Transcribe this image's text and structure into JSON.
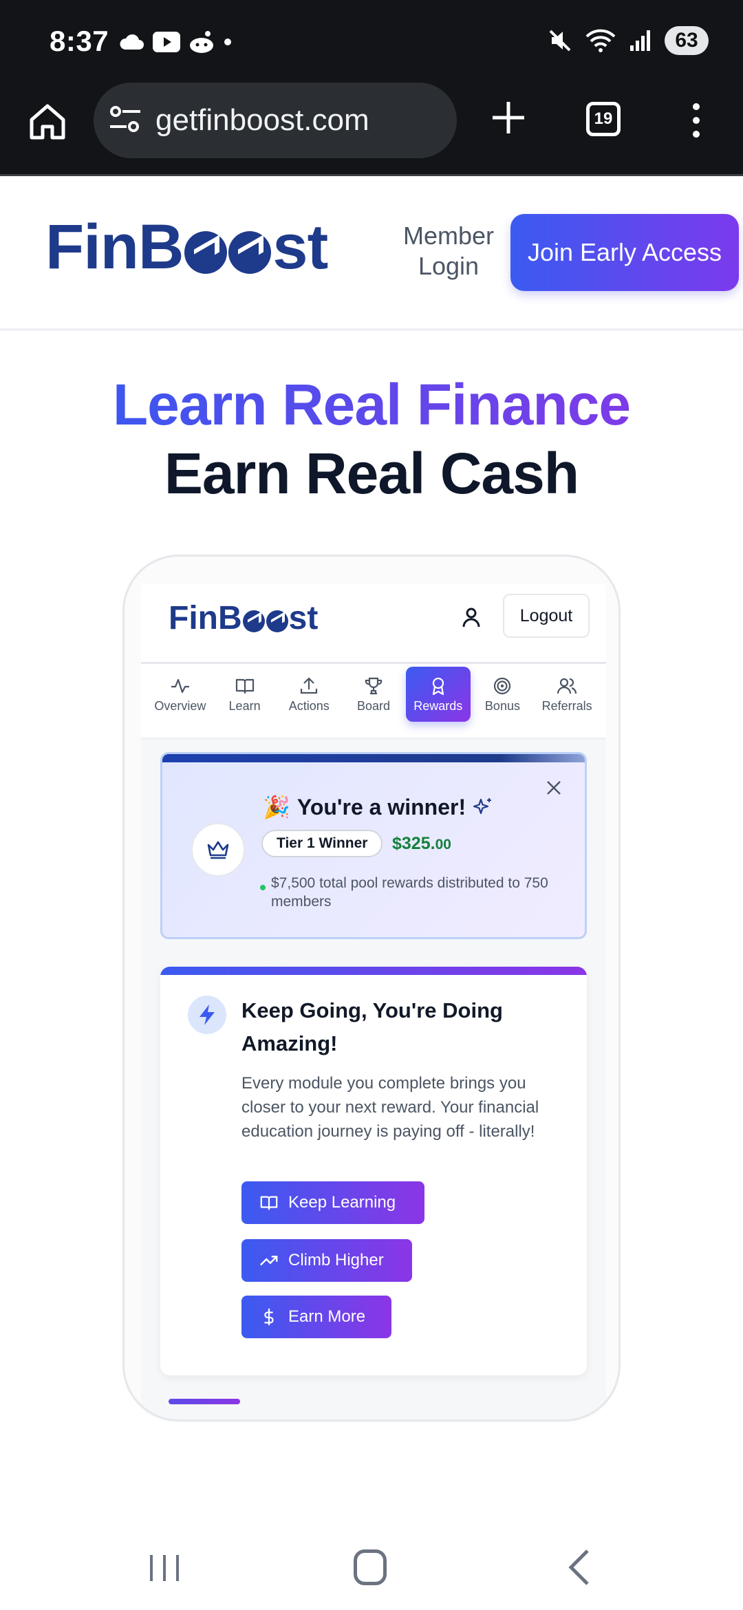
{
  "status_bar": {
    "time": "8:37",
    "left_icons": [
      "cloud-icon",
      "youtube-icon",
      "reddit-icon",
      "dot-icon"
    ],
    "right_icons": [
      "mute-icon",
      "wifi-icon",
      "signal-icon"
    ],
    "battery": "63"
  },
  "browser": {
    "url": "getfinboost.com",
    "tab_count": "19"
  },
  "site_header": {
    "logo_text_start": "FinB",
    "logo_text_end": "st",
    "member_login": "Member Login",
    "join_button": "Join Early Access"
  },
  "hero": {
    "line1": "Learn Real Finance",
    "line2": "Earn Real Cash"
  },
  "app": {
    "logo_text_start": "FinB",
    "logo_text_end": "st",
    "logout": "Logout",
    "nav": [
      {
        "label": "Overview",
        "icon": "activity-icon"
      },
      {
        "label": "Learn",
        "icon": "book-icon"
      },
      {
        "label": "Actions",
        "icon": "upload-icon"
      },
      {
        "label": "Board",
        "icon": "trophy-icon"
      },
      {
        "label": "Rewards",
        "icon": "award-icon",
        "active": true
      },
      {
        "label": "Bonus",
        "icon": "target-icon"
      },
      {
        "label": "Referrals",
        "icon": "users-icon"
      }
    ],
    "winner": {
      "emoji": "🎉",
      "title": "You're a winner!",
      "tier": "Tier 1 Winner",
      "amount_main": "$325.",
      "amount_cents": "00",
      "pool_text": "$7,500 total pool rewards distributed to 750 members"
    },
    "encourage": {
      "title": "Keep Going, You're Doing Amazing!",
      "body": "Every module you complete brings you closer to your next reward. Your financial education journey is paying off - literally!",
      "buttons": [
        "Keep Learning",
        "Climb Higher",
        "Earn More"
      ]
    }
  },
  "colors": {
    "brand_navy": "#1e3a8a",
    "gradient_start": "#3b5bf0",
    "gradient_end": "#8b35e6",
    "money_green": "#15803d"
  }
}
